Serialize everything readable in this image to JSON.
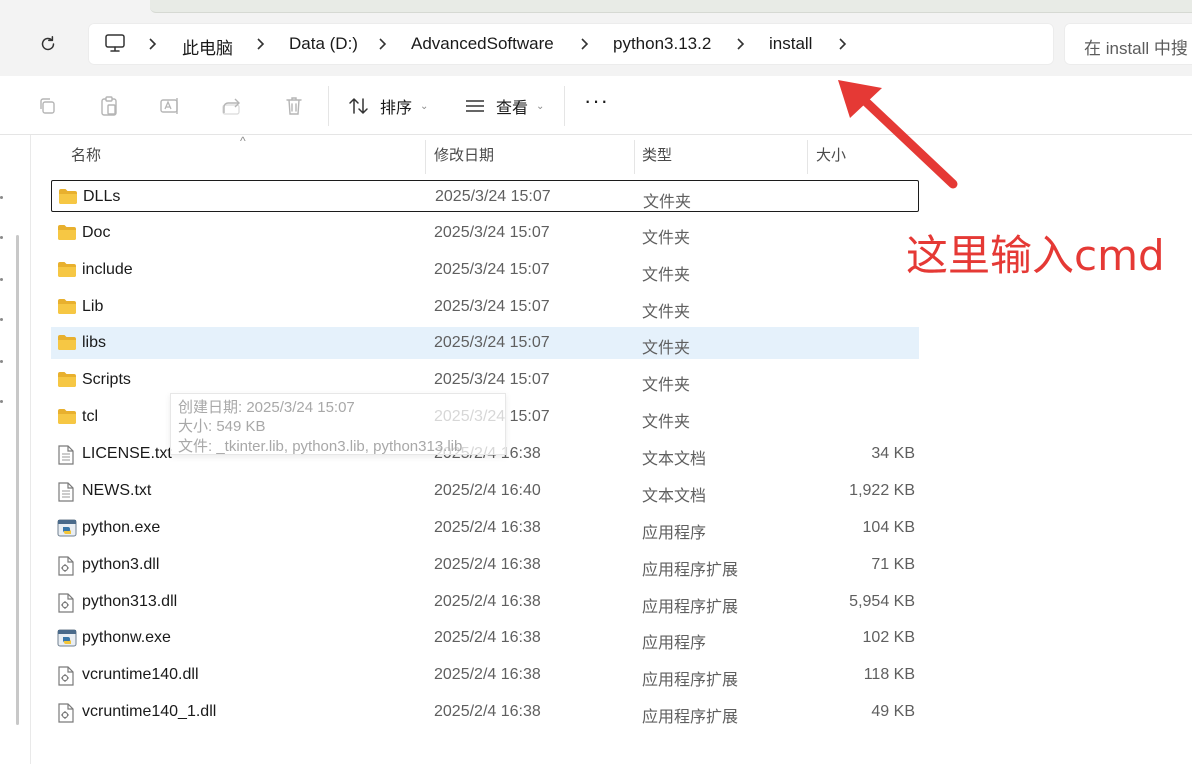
{
  "address_bar": {
    "crumbs": [
      "此电脑",
      "Data (D:)",
      "AdvancedSoftware",
      "python3.13.2",
      "install"
    ],
    "search_placeholder": "在 install 中搜"
  },
  "toolbar": {
    "sort_label": "排序",
    "view_label": "查看",
    "more_label": "···"
  },
  "columns": {
    "name": "名称",
    "modified": "修改日期",
    "type": "类型",
    "size": "大小"
  },
  "files": [
    {
      "name": "DLLs",
      "date": "2025/3/24 15:07",
      "type": "文件夹",
      "size": "",
      "icon": "folder-icon"
    },
    {
      "name": "Doc",
      "date": "2025/3/24 15:07",
      "type": "文件夹",
      "size": "",
      "icon": "folder-icon"
    },
    {
      "name": "include",
      "date": "2025/3/24 15:07",
      "type": "文件夹",
      "size": "",
      "icon": "folder-icon"
    },
    {
      "name": "Lib",
      "date": "2025/3/24 15:07",
      "type": "文件夹",
      "size": "",
      "icon": "folder-icon"
    },
    {
      "name": "libs",
      "date": "2025/3/24 15:07",
      "type": "文件夹",
      "size": "",
      "icon": "folder-icon"
    },
    {
      "name": "Scripts",
      "date": "2025/3/24 15:07",
      "type": "文件夹",
      "size": "",
      "icon": "folder-icon"
    },
    {
      "name": "tcl",
      "date": "2025/3/24 15:07",
      "type": "文件夹",
      "size": "",
      "icon": "folder-icon"
    },
    {
      "name": "LICENSE.txt",
      "date": "2025/2/4 16:38",
      "type": "文本文档",
      "size": "34 KB",
      "icon": "text-file-icon"
    },
    {
      "name": "NEWS.txt",
      "date": "2025/2/4 16:40",
      "type": "文本文档",
      "size": "1,922 KB",
      "icon": "text-file-icon"
    },
    {
      "name": "python.exe",
      "date": "2025/2/4 16:38",
      "type": "应用程序",
      "size": "104 KB",
      "icon": "python-exe-icon"
    },
    {
      "name": "python3.dll",
      "date": "2025/2/4 16:38",
      "type": "应用程序扩展",
      "size": "71 KB",
      "icon": "dll-file-icon"
    },
    {
      "name": "python313.dll",
      "date": "2025/2/4 16:38",
      "type": "应用程序扩展",
      "size": "5,954 KB",
      "icon": "dll-file-icon"
    },
    {
      "name": "pythonw.exe",
      "date": "2025/2/4 16:38",
      "type": "应用程序",
      "size": "102 KB",
      "icon": "python-exe-icon"
    },
    {
      "name": "vcruntime140.dll",
      "date": "2025/2/4 16:38",
      "type": "应用程序扩展",
      "size": "118 KB",
      "icon": "dll-file-icon"
    },
    {
      "name": "vcruntime140_1.dll",
      "date": "2025/2/4 16:38",
      "type": "应用程序扩展",
      "size": "49 KB",
      "icon": "dll-file-icon"
    }
  ],
  "selected_index": 0,
  "hover_index": 4,
  "tooltip": {
    "created": "创建日期: 2025/3/24 15:07",
    "size": "大小: 549 KB",
    "files": "文件: _tkinter.lib, python3.lib, python313.lib"
  },
  "annotation": {
    "text": "这里输入cmd",
    "color": "#e53935"
  },
  "colors": {
    "folder": "#f6c744",
    "hover_row": "#e5f1fb"
  }
}
